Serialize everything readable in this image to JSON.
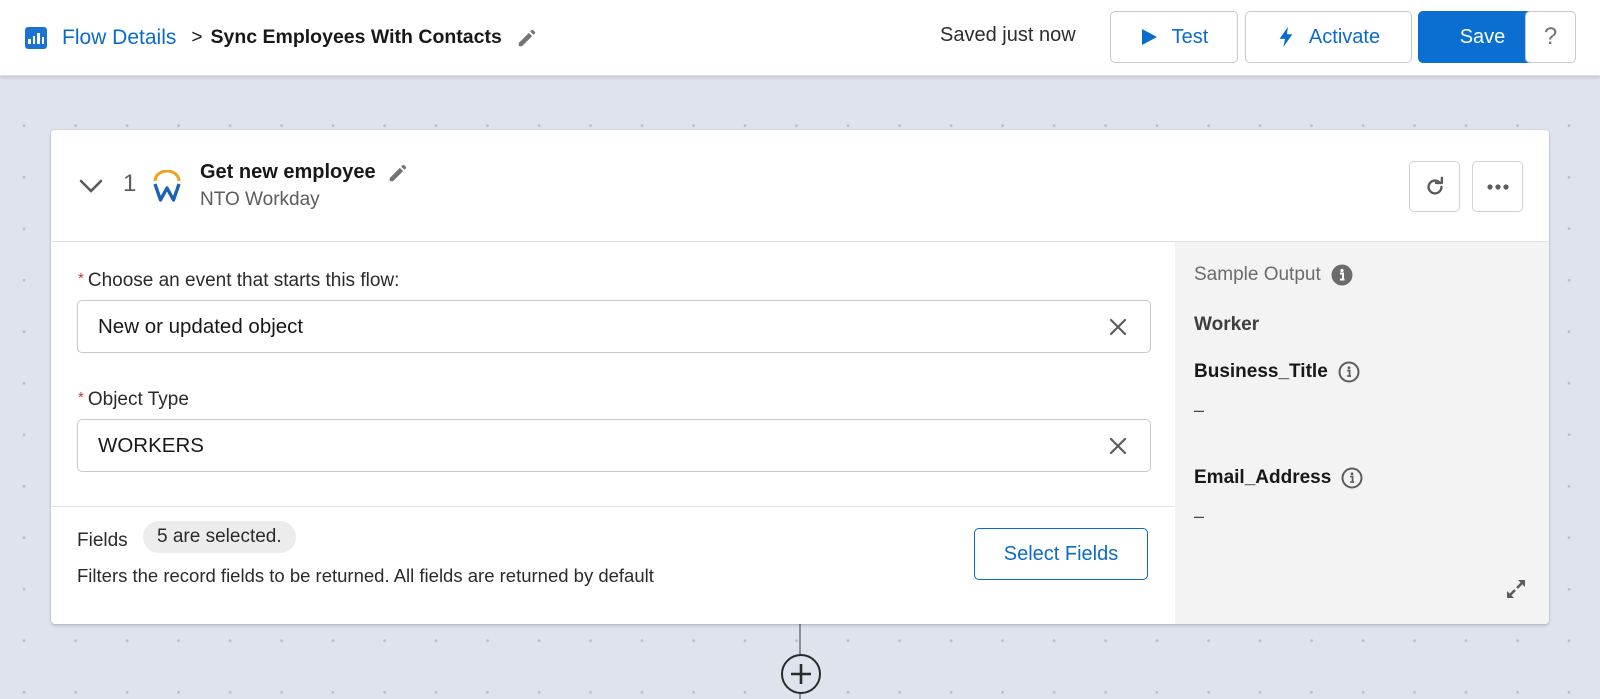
{
  "header": {
    "breadcrumb_link": "Flow Details",
    "breadcrumb_separator": ">",
    "flow_title": "Sync Employees With Contacts",
    "save_status": "Saved just now",
    "buttons": {
      "test": "Test",
      "activate": "Activate",
      "save": "Save",
      "help": "?"
    },
    "colors": {
      "brand": "#0b6bcb",
      "primary_button": "#0b6fd1"
    }
  },
  "step": {
    "number": "1",
    "title": "Get new employee",
    "connection": "NTO Workday",
    "app_icon": "workday-logo-icon",
    "event_field": {
      "label": "Choose an event that starts this flow:",
      "required": "*",
      "value": "New or updated object"
    },
    "object_type_field": {
      "label": "Object Type",
      "required": "*",
      "value": "WORKERS"
    },
    "fields": {
      "label": "Fields",
      "selected_badge": "5 are selected.",
      "help_text": "Filters the record fields to be returned. All fields are returned by default",
      "select_button": "Select Fields"
    }
  },
  "sample_output": {
    "title": "Sample Output",
    "object_name": "Worker",
    "fields": [
      {
        "name": "Business_Title",
        "value": "–"
      },
      {
        "name": "Email_Address",
        "value": "–"
      }
    ]
  }
}
